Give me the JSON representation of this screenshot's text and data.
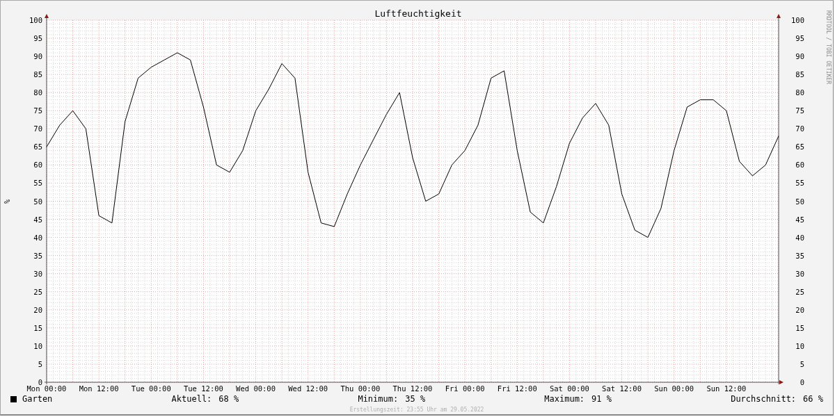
{
  "chart_data": {
    "type": "line",
    "grid": true,
    "title": "Luftfeuchtigkeit",
    "ylabel": "%",
    "ylim": [
      0,
      100
    ],
    "categories": [
      "Mon 00:00",
      null,
      null,
      null,
      "Mon 12:00",
      null,
      null,
      null,
      "Tue 00:00",
      null,
      null,
      null,
      "Tue 12:00",
      null,
      null,
      null,
      "Wed 00:00",
      null,
      null,
      null,
      "Wed 12:00",
      null,
      null,
      null,
      "Thu 00:00",
      null,
      null,
      null,
      "Thu 12:00",
      null,
      null,
      null,
      "Fri 00:00",
      null,
      null,
      null,
      "Fri 12:00",
      null,
      null,
      null,
      "Sat 00:00",
      null,
      null,
      null,
      "Sat 12:00",
      null,
      null,
      null,
      "Sun 00:00",
      null,
      null,
      null,
      "Sun 12:00",
      null,
      null,
      null,
      null
    ],
    "series": [
      {
        "name": "Garten",
        "color": "#000000",
        "values": [
          65,
          71,
          75,
          70,
          46,
          44,
          72,
          84,
          87,
          89,
          91,
          89,
          76,
          60,
          58,
          64,
          75,
          81,
          88,
          84,
          58,
          44,
          43,
          52,
          60,
          67,
          74,
          80,
          62,
          50,
          52,
          60,
          64,
          71,
          84,
          86,
          64,
          47,
          44,
          54,
          66,
          73,
          77,
          71,
          52,
          42,
          40,
          48,
          64,
          76,
          78,
          78,
          75,
          61,
          57,
          60,
          68
        ]
      }
    ],
    "yticks": [
      0,
      5,
      10,
      15,
      20,
      25,
      30,
      35,
      40,
      45,
      50,
      55,
      60,
      65,
      70,
      75,
      80,
      85,
      90,
      95,
      100
    ]
  },
  "right_yticks": [
    "100",
    "95",
    "90",
    "85",
    "80",
    "75",
    "70",
    "65",
    "60",
    "55",
    "50",
    "45",
    "40",
    "35",
    "30",
    "25",
    "20",
    "15",
    "10",
    "5",
    "0"
  ],
  "credit": "RRDTOOL / TOBI OETIKER",
  "stats": [
    {
      "label": "Aktuell:",
      "value": "68 %"
    },
    {
      "label": "Minimum:",
      "value": "35 %"
    },
    {
      "label": "Maximum:",
      "value": "91 %"
    },
    {
      "label": "Durchschnitt:",
      "value": "66 %"
    }
  ],
  "footer": "Erstellungszeit: 23:55 Uhr am 29.05.2022"
}
